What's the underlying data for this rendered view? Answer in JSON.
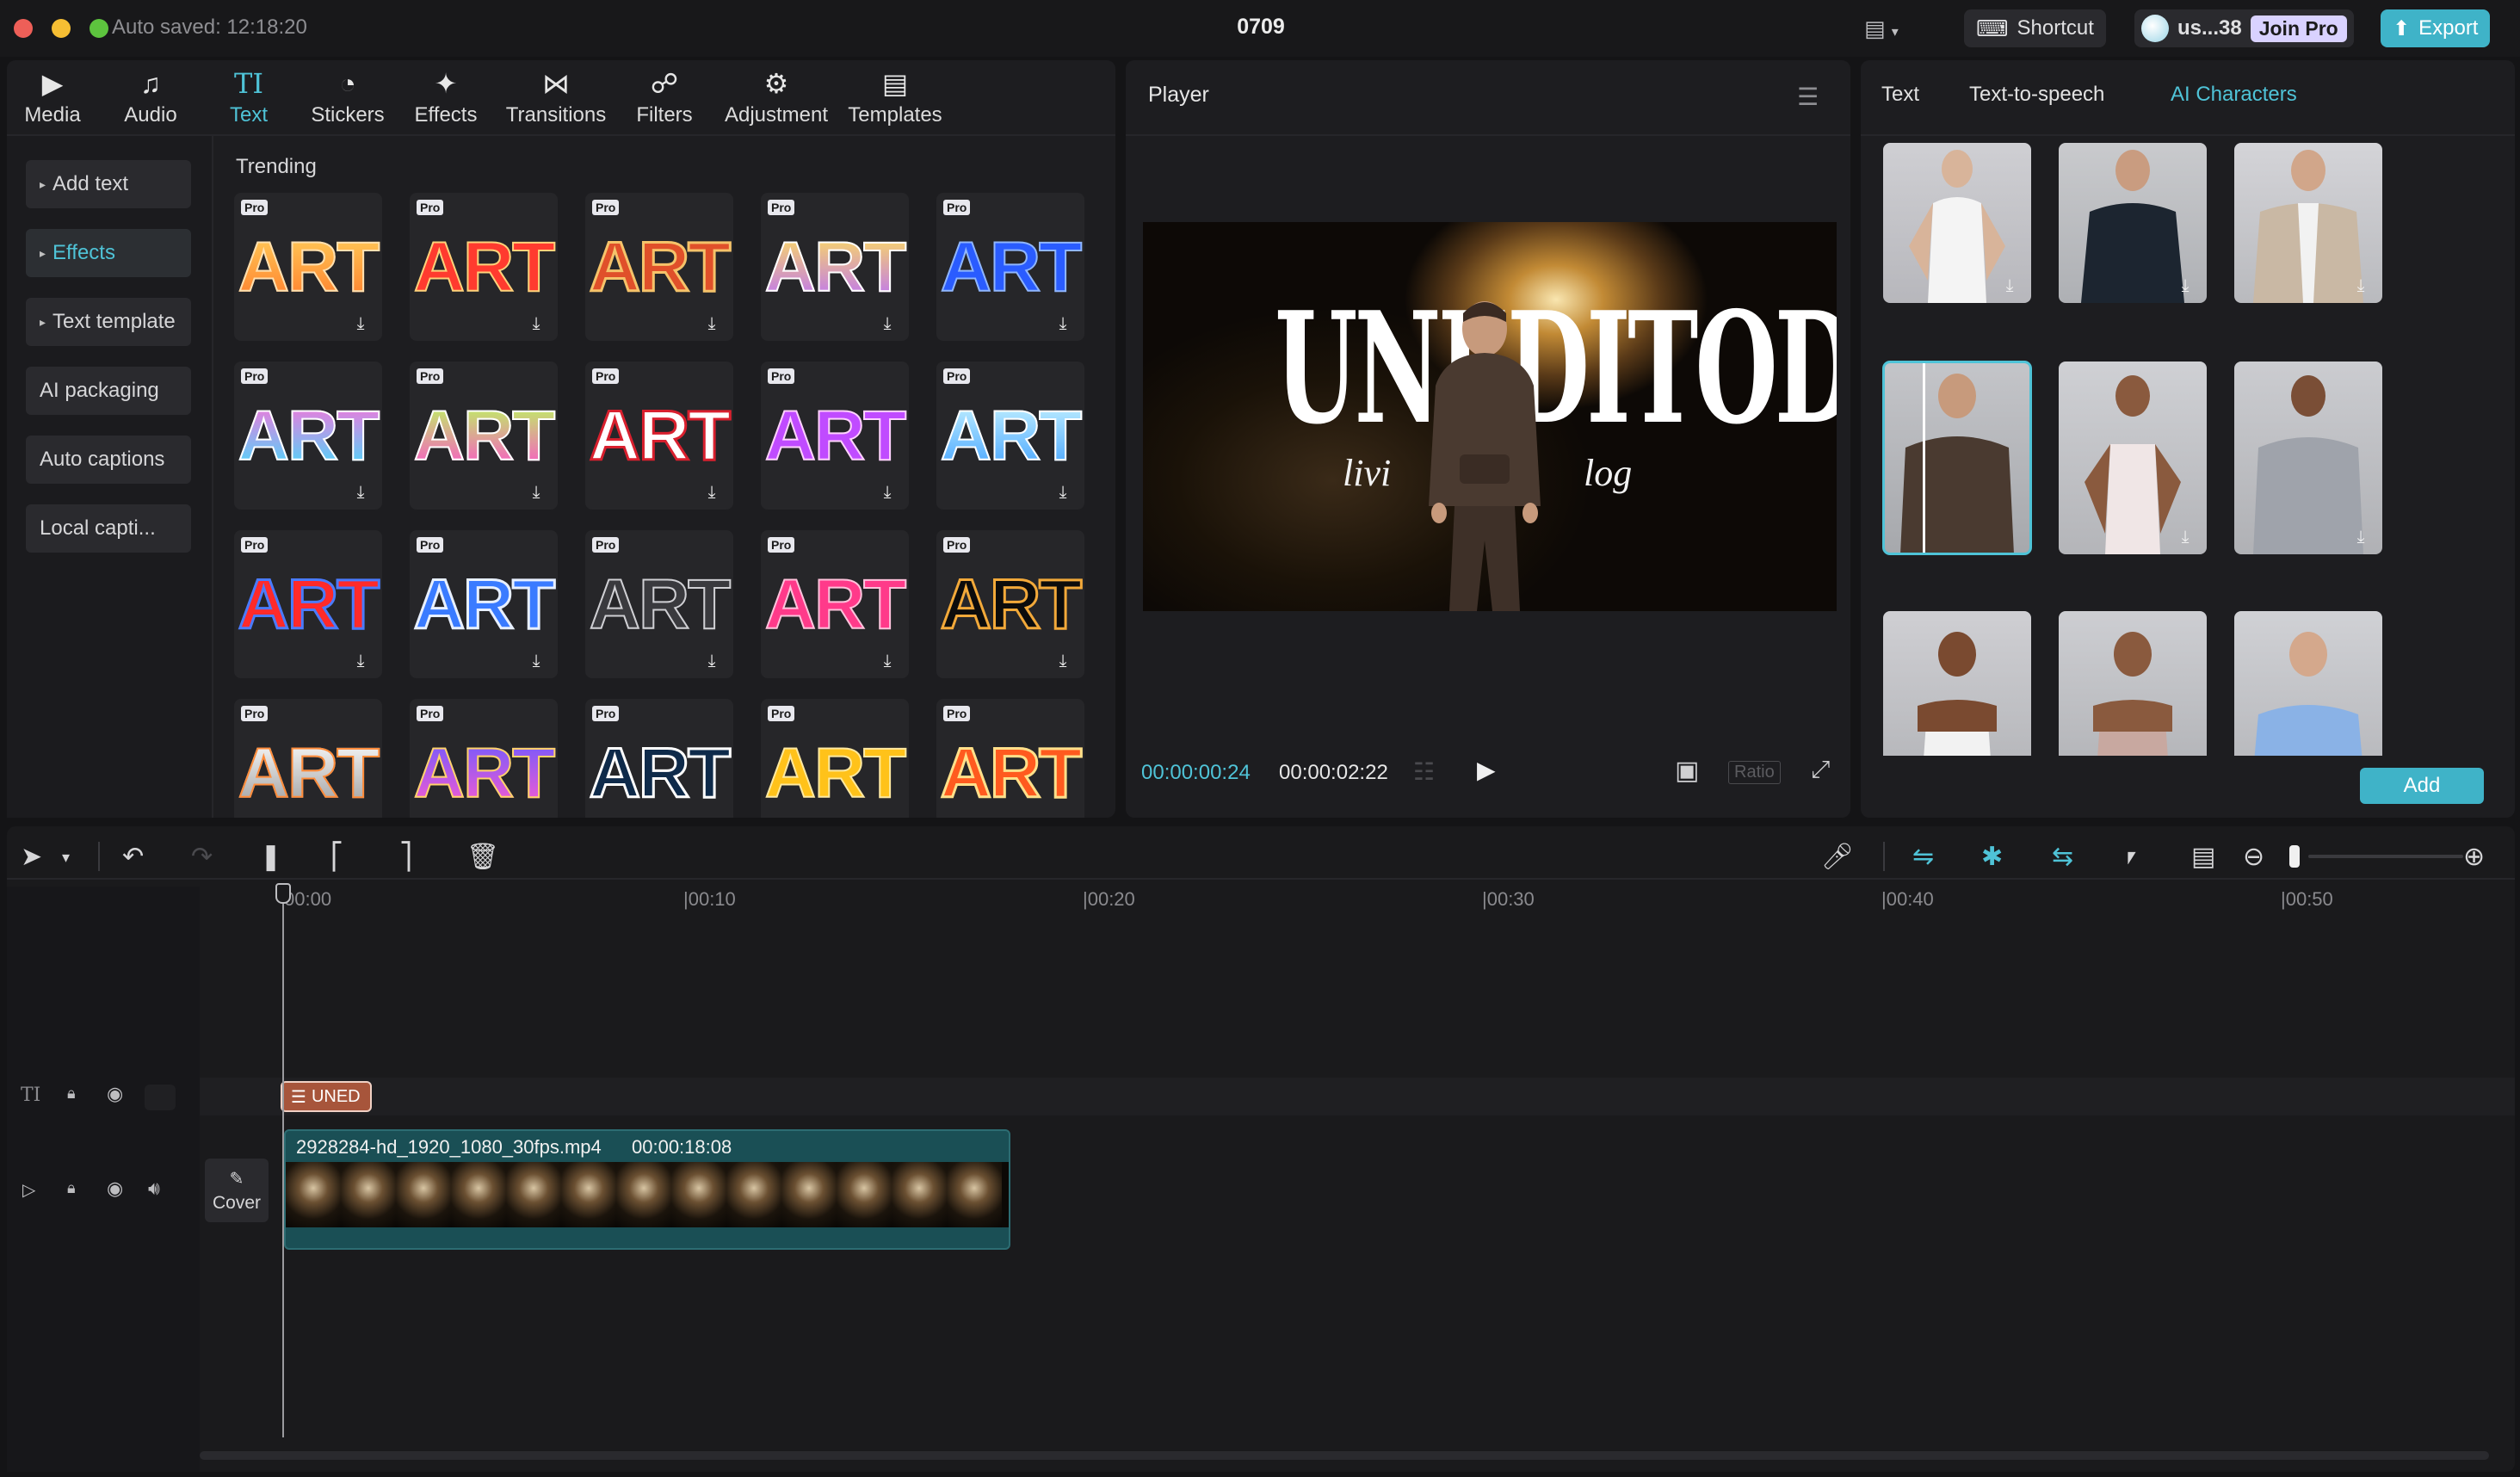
{
  "titlebar": {
    "autosaved": "Auto saved: 12:18:20",
    "project_name": "0709",
    "shortcut_label": "Shortcut",
    "user_label": "us...38",
    "join_pro_label": "Join Pro",
    "export_label": "Export"
  },
  "tools": [
    {
      "label": "Media",
      "icon": "media-icon"
    },
    {
      "label": "Audio",
      "icon": "audio-icon"
    },
    {
      "label": "Text",
      "icon": "text-icon",
      "active": true
    },
    {
      "label": "Stickers",
      "icon": "stickers-icon"
    },
    {
      "label": "Effects",
      "icon": "effects-icon"
    },
    {
      "label": "Transitions",
      "icon": "transitions-icon"
    },
    {
      "label": "Filters",
      "icon": "filters-icon"
    },
    {
      "label": "Adjustment",
      "icon": "adjustment-icon"
    },
    {
      "label": "Templates",
      "icon": "templates-icon"
    }
  ],
  "text_sidebar": {
    "items": [
      "Add text",
      "Effects",
      "Text template",
      "AI packaging",
      "Auto captions",
      "Local capti..."
    ],
    "active_index": 1
  },
  "trending": {
    "heading": "Trending",
    "tile_word": "ART",
    "badge": "Pro"
  },
  "player": {
    "title": "Player",
    "overlay_title": "UNEDITODAY",
    "overlay_subtitle_left": "livi",
    "overlay_subtitle_right": "log",
    "time_current": "00:00:00:24",
    "time_total": "00:00:02:22",
    "ratio_label": "Ratio"
  },
  "right_panel": {
    "tabs": [
      "Text",
      "Text-to-speech",
      "AI Characters"
    ],
    "active_tab": 2,
    "add_label": "Add"
  },
  "timeline": {
    "ticks": [
      "00:00",
      "00:10",
      "00:20",
      "00:30",
      "00:40",
      "00:50"
    ],
    "text_clip_label": "UNED",
    "video_clip_name": "2928284-hd_1920_1080_30fps.mp4",
    "video_clip_duration": "00:00:18:08",
    "cover_label": "Cover"
  },
  "colors": {
    "accent": "#4fc3d7",
    "export_bg": "#3fb3c8",
    "text_clip": "#a7553b",
    "video_clip": "#1a4f55"
  }
}
